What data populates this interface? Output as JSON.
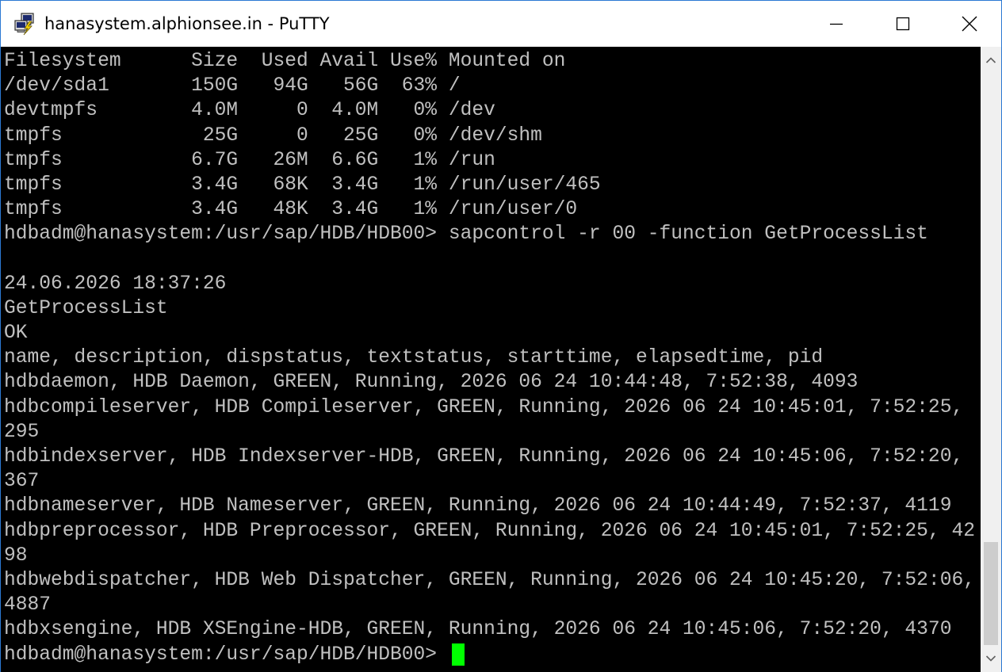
{
  "window": {
    "title": "hanasystem.alphionsee.in - PuTTY",
    "app_icon": "putty-icon",
    "controls": {
      "minimize_icon": "minimize-icon",
      "maximize_icon": "maximize-icon",
      "close_icon": "close-icon"
    }
  },
  "terminal": {
    "colors": {
      "background": "#000000",
      "text": "#c0c0c0",
      "cursor": "#00ff00"
    },
    "lines": [
      "Filesystem      Size  Used Avail Use% Mounted on",
      "/dev/sda1       150G   94G   56G  63% /",
      "devtmpfs        4.0M     0  4.0M   0% /dev",
      "tmpfs            25G     0   25G   0% /dev/shm",
      "tmpfs           6.7G   26M  6.6G   1% /run",
      "tmpfs           3.4G   68K  3.4G   1% /run/user/465",
      "tmpfs           3.4G   48K  3.4G   1% /run/user/0",
      "hdbadm@hanasystem:/usr/sap/HDB/HDB00> sapcontrol -r 00 -function GetProcessList",
      "",
      "24.06.2026 18:37:26",
      "GetProcessList",
      "OK",
      "name, description, dispstatus, textstatus, starttime, elapsedtime, pid",
      "hdbdaemon, HDB Daemon, GREEN, Running, 2026 06 24 10:44:48, 7:52:38, 4093",
      "hdbcompileserver, HDB Compileserver, GREEN, Running, 2026 06 24 10:45:01, 7:52:25,",
      "295",
      "hdbindexserver, HDB Indexserver-HDB, GREEN, Running, 2026 06 24 10:45:06, 7:52:20,",
      "367",
      "hdbnameserver, HDB Nameserver, GREEN, Running, 2026 06 24 10:44:49, 7:52:37, 4119",
      "hdbpreprocessor, HDB Preprocessor, GREEN, Running, 2026 06 24 10:45:01, 7:52:25, 42",
      "98",
      "hdbwebdispatcher, HDB Web Dispatcher, GREEN, Running, 2026 06 24 10:45:20, 7:52:06,",
      "4887",
      "hdbxsengine, HDB XSEngine-HDB, GREEN, Running, 2026 06 24 10:45:06, 7:52:20, 4370"
    ],
    "prompt": "hdbadm@hanasystem:/usr/sap/HDB/HDB00> "
  },
  "scrollbar": {
    "up_icon": "scroll-up-arrow-icon",
    "down_icon": "scroll-down-arrow-icon",
    "thumb_position_fraction": 0.82,
    "thumb_size_fraction": 0.18
  }
}
